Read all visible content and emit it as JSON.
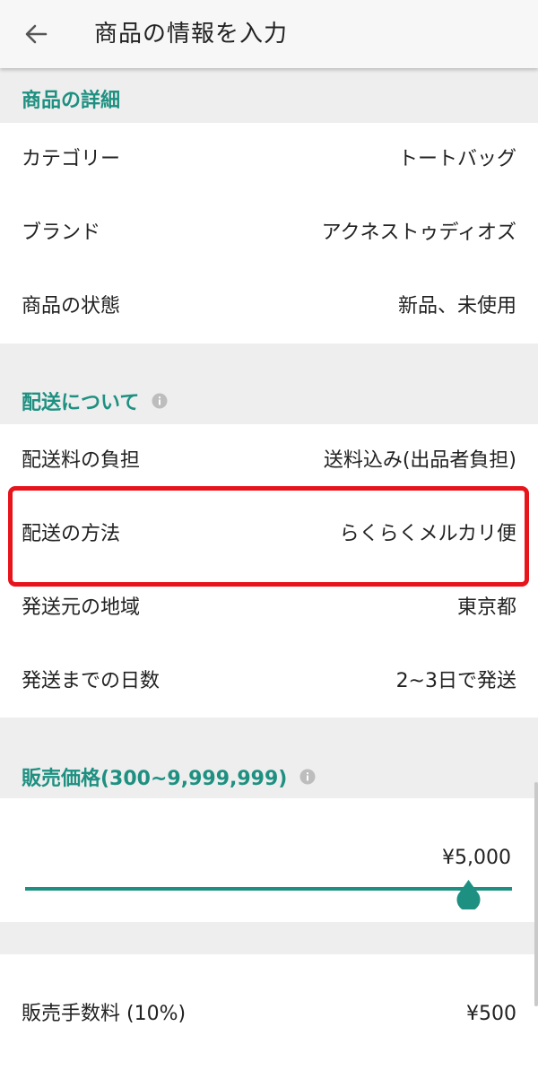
{
  "app_bar": {
    "title": "商品の情報を入力",
    "back_icon": "arrow-left-icon"
  },
  "sections": {
    "details": {
      "title": "商品の詳細",
      "rows": [
        {
          "label": "カテゴリー",
          "value": "トートバッグ"
        },
        {
          "label": "ブランド",
          "value": "アクネストゥディオズ"
        },
        {
          "label": "商品の状態",
          "value": "新品、未使用"
        }
      ]
    },
    "shipping": {
      "title": "配送について",
      "info_icon": "info-icon",
      "rows": [
        {
          "label": "配送料の負担",
          "value": "送料込み(出品者負担)"
        },
        {
          "label": "配送の方法",
          "value": "らくらくメルカリ便"
        },
        {
          "label": "発送元の地域",
          "value": "東京都"
        },
        {
          "label": "発送までの日数",
          "value": "2~3日で発送"
        }
      ]
    },
    "price": {
      "title": "販売価格(300~9,999,999)",
      "info_icon": "info-icon",
      "value": "¥5,000",
      "slider_fraction": 0.91
    },
    "fees": {
      "rows": [
        {
          "label": "販売手数料 (10%)",
          "value": "¥500"
        }
      ]
    }
  },
  "colors": {
    "accent": "#1e9081",
    "highlight": "#e8141b",
    "background": "#eeeeee",
    "card": "#ffffff"
  }
}
